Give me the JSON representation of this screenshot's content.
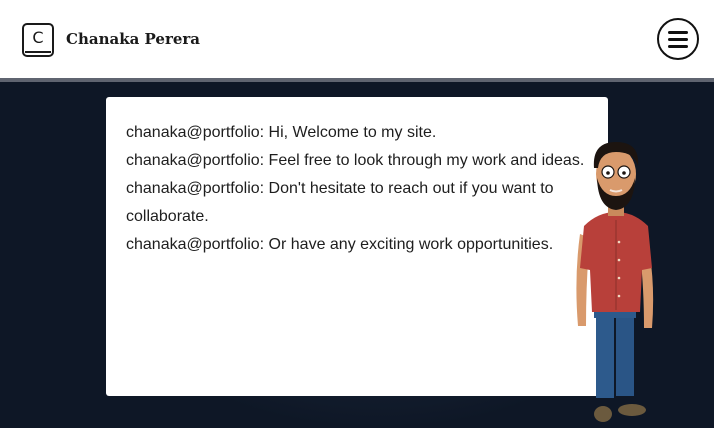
{
  "header": {
    "logo_letter": "C",
    "site_name": "Chanaka Perera"
  },
  "icons": {
    "logo": "logo-c-icon",
    "menu": "hamburger-menu-icon",
    "character": "cartoon-character-illustration"
  },
  "terminal": {
    "lines": [
      "chanaka@portfolio: Hi, Welcome to my site.",
      "chanaka@portfolio: Feel free to look through my work and ideas.",
      "chanaka@portfolio: Don't hesitate to reach out if you want to collaborate.",
      "chanaka@portfolio: Or have any exciting work opportunities."
    ]
  },
  "colors": {
    "background": "#0e1726",
    "header": "#ffffff",
    "header_border": "#5f6470",
    "terminal_bg": "#ffffff",
    "shirt": "#b8403a",
    "pants": "#2d5a8c"
  }
}
